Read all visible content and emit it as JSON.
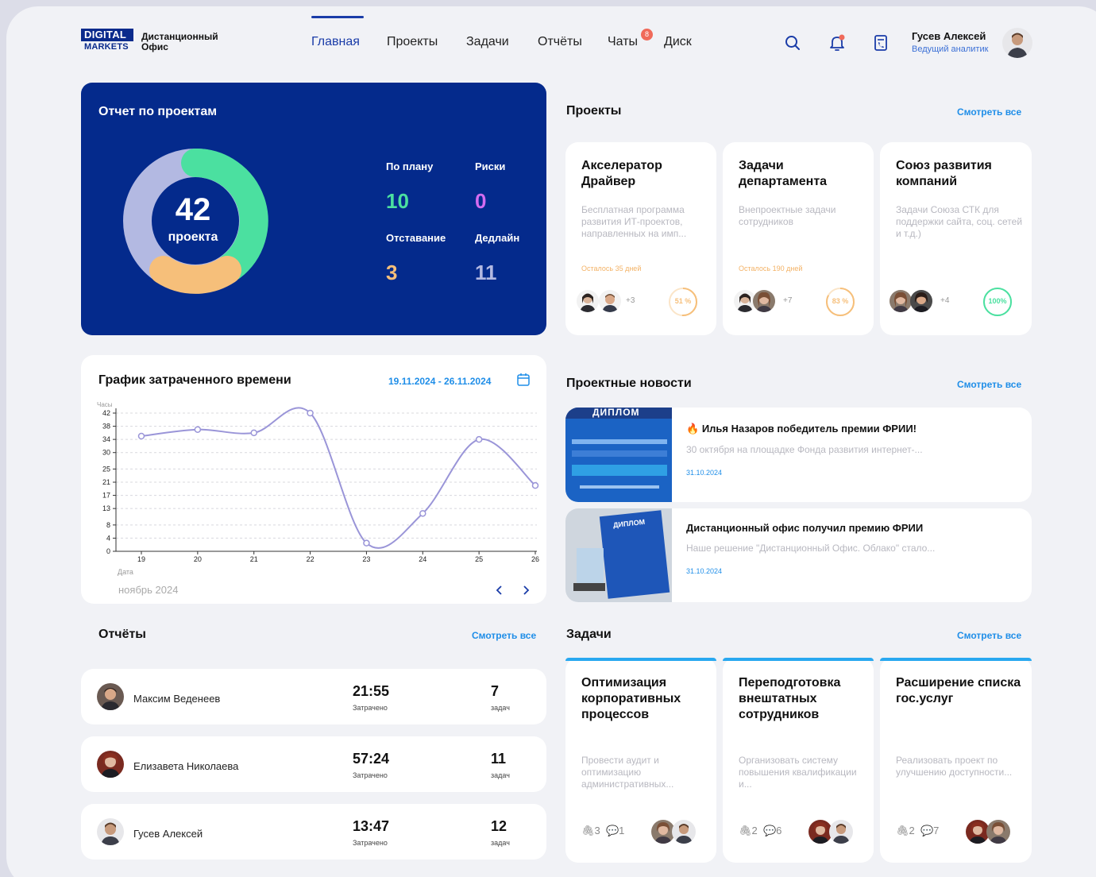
{
  "header": {
    "logo_line1": "DIGITAL",
    "logo_line2": "MARKETS",
    "logo_text": "Дистанционный Офис",
    "nav": [
      "Главная",
      "Проекты",
      "Задачи",
      "Отчёты",
      "Чаты",
      "Диск"
    ],
    "active_nav": "Главная",
    "chat_badge": "8",
    "user_name": "Гусев Алексей",
    "user_role": "Ведущий аналитик"
  },
  "report": {
    "title": "Отчет по проектам",
    "total": "42",
    "total_label": "проекта",
    "stats": [
      {
        "label": "По плану",
        "value": "10",
        "color": "#4be0a0"
      },
      {
        "label": "Риски",
        "value": "0",
        "color": "#d46cf0"
      },
      {
        "label": "Отставание",
        "value": "3",
        "color": "#f6bf7a"
      },
      {
        "label": "Дедлайн",
        "value": "11",
        "color": "#b3b9e2"
      }
    ]
  },
  "projects": {
    "title": "Проекты",
    "see_all": "Смотреть все",
    "items": [
      {
        "title": "Акселератор Драйвер",
        "desc": "Бесплатная программа развития ИТ-проектов, направленных на имп...",
        "deadline": "Осталось 35 дней",
        "extra": "+3",
        "progress": "51 %",
        "progress_value": 51,
        "ring_color": "#f6bf7a"
      },
      {
        "title": "Задачи департамента",
        "desc": "Внепроектные задачи сотрудников",
        "deadline": "Осталось 190 дней",
        "extra": "+7",
        "progress": "83 %",
        "progress_value": 83,
        "ring_color": "#f6bf7a"
      },
      {
        "title": "Союз развития компаний",
        "desc": "Задачи Союза СТК для поддержки сайта, соц. сетей и т.д.)",
        "deadline": "",
        "extra": "+4",
        "progress": "100%",
        "progress_value": 100,
        "ring_color": "#4be0a0"
      }
    ]
  },
  "time_chart": {
    "title": "График затраченного времени",
    "date_range": "19.11.2024 - 26.11.2024",
    "month": "ноябрь 2024"
  },
  "chart_data": {
    "type": "line",
    "title": "График затраченного времени",
    "ylabel": "Часы",
    "xlabel": "Дата",
    "x": [
      19,
      20,
      21,
      22,
      23,
      24,
      25,
      26
    ],
    "y": [
      35,
      37,
      36,
      42,
      2.5,
      11.5,
      34,
      20
    ],
    "yticks": [
      0,
      4,
      8,
      13,
      17,
      21,
      25,
      30,
      34,
      38,
      42
    ],
    "ylim": [
      0,
      42
    ],
    "grid": true,
    "color": "#9a95d8"
  },
  "news": {
    "title": "Проектные новости",
    "see_all": "Смотреть все",
    "items": [
      {
        "emoji": "🔥",
        "headline": "Илья Назаров победитель премии ФРИИ!",
        "text": "30 октября на площадке Фонда развития интернет-...",
        "date": "31.10.2024",
        "img_caption": "ДИПЛОМ"
      },
      {
        "headline": "Дистанционный офис получил премию ФРИИ",
        "text": "Наше решение \"Дистанционный Офис. Облако\" стало...",
        "date": "31.10.2024",
        "img_caption": "ДИПЛОМ"
      }
    ]
  },
  "reports": {
    "title": "Отчёты",
    "see_all": "Смотреть все",
    "rows": [
      {
        "name": "Максим Веденеев",
        "time": "21:55",
        "time_label": "Затрачено",
        "count": "7",
        "count_label": "задач"
      },
      {
        "name": "Елизавета Николаева",
        "time": "57:24",
        "time_label": "Затрачено",
        "count": "11",
        "count_label": "задач"
      },
      {
        "name": "Гусев Алексей",
        "time": "13:47",
        "time_label": "Затрачено",
        "count": "12",
        "count_label": "задач"
      }
    ]
  },
  "tasks": {
    "title": "Задачи",
    "see_all": "Смотреть все",
    "items": [
      {
        "title": "Оптимизация корпоративных процессов",
        "desc": "Провести аудит и оптимизацию административных...",
        "attach": "3",
        "comments": "1"
      },
      {
        "title": "Переподготовка внештатных сотрудников",
        "desc": "Организовать систему повышения квалификации и...",
        "attach": "2",
        "comments": "6"
      },
      {
        "title": "Расширение списка гос.услуг",
        "desc": "Реализовать проект по улучшению доступности...",
        "attach": "2",
        "comments": "7"
      }
    ]
  }
}
